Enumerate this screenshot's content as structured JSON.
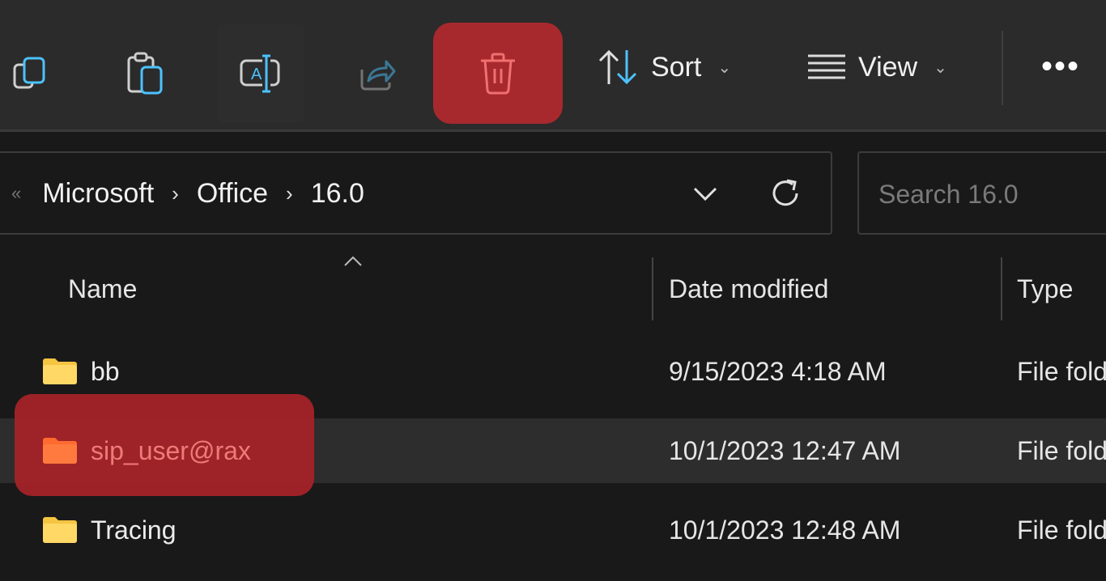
{
  "toolbar": {
    "buttons": [
      {
        "name": "copy",
        "icon": "copy-icon"
      },
      {
        "name": "paste",
        "icon": "paste-icon"
      },
      {
        "name": "rename",
        "icon": "rename-icon"
      },
      {
        "name": "share",
        "icon": "share-icon",
        "disabled": true
      },
      {
        "name": "delete",
        "icon": "trash-icon",
        "highlighted": true
      }
    ],
    "sort_label": "Sort",
    "view_label": "View",
    "more_label": "•••"
  },
  "address_bar": {
    "overflow_glyph": "«",
    "crumbs": [
      "Microsoft",
      "Office",
      "16.0"
    ],
    "separator": "›"
  },
  "search": {
    "placeholder": "Search 16.0",
    "value": ""
  },
  "columns": {
    "name": "Name",
    "date": "Date modified",
    "type": "Type"
  },
  "files": [
    {
      "name": "bb",
      "date": "9/15/2023 4:18 AM",
      "type": "File folder"
    },
    {
      "name": "sip_user@rax",
      "date": "10/1/2023 12:47 AM",
      "type": "File folder",
      "selected": true
    },
    {
      "name": "Tracing",
      "date": "10/1/2023 12:48 AM",
      "type": "File folder"
    }
  ],
  "colors": {
    "accent": "#4cc2ff",
    "highlight": "#a8292d",
    "folder": "#f5c542"
  }
}
